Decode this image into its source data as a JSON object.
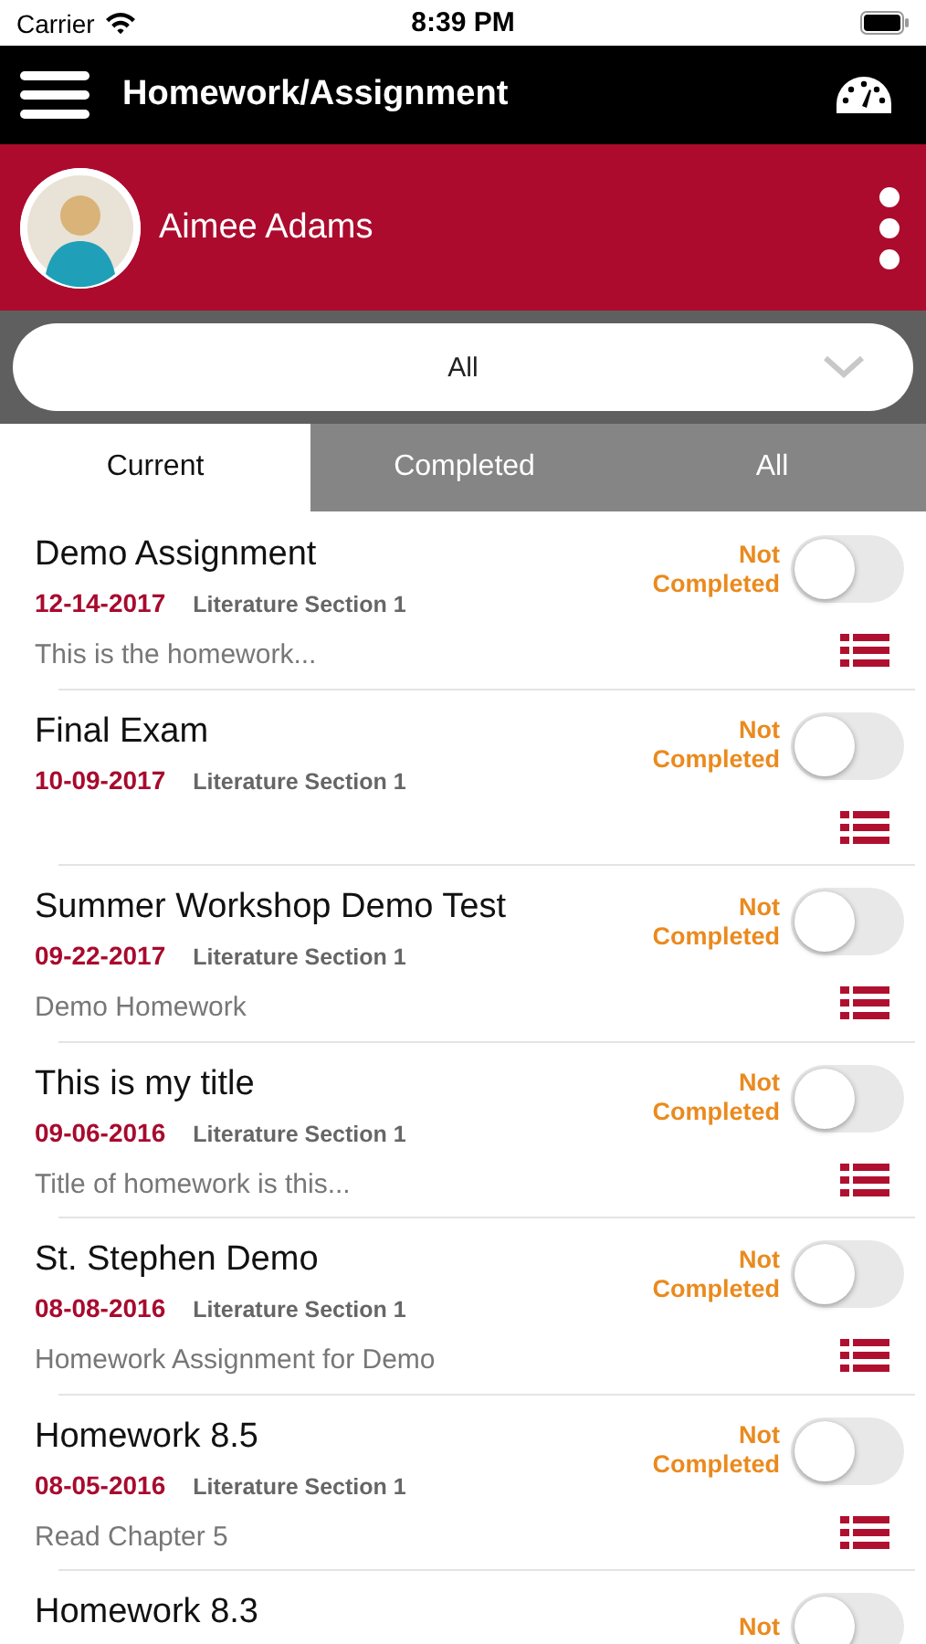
{
  "status_bar": {
    "carrier": "Carrier",
    "time": "8:39 PM"
  },
  "header": {
    "title": "Homework/Assignment"
  },
  "profile": {
    "name": "Aimee Adams"
  },
  "filter": {
    "value": "All"
  },
  "tabs": [
    {
      "label": "Current",
      "selected": true
    },
    {
      "label": "Completed",
      "selected": false
    },
    {
      "label": "All",
      "selected": false
    }
  ],
  "assignments": [
    {
      "title": "Demo Assignment",
      "date": "12-14-2017",
      "section": "Literature Section 1",
      "description": "This is the homework...",
      "status": "Not Completed",
      "on": false
    },
    {
      "title": "Final Exam",
      "date": "10-09-2017",
      "section": "Literature Section 1",
      "status": "Not Completed",
      "on": false
    },
    {
      "title": "Summer Workshop Demo Test",
      "date": "09-22-2017",
      "section": "Literature Section 1",
      "description": "Demo Homework",
      "status": "Not Completed",
      "on": false
    },
    {
      "title": "This is my title",
      "date": "09-06-2016",
      "section": "Literature Section 1",
      "description": "Title of homework is this...",
      "status": "Not Completed",
      "on": false
    },
    {
      "title": "St. Stephen Demo",
      "date": "08-08-2016",
      "section": "Literature Section 1",
      "description": "Homework Assignment for Demo",
      "status": "Not Completed",
      "on": false
    },
    {
      "title": "Homework 8.5",
      "date": "08-05-2016",
      "section": "Literature Section 1",
      "description": "Read Chapter 5",
      "status": "Not Completed",
      "on": false
    },
    {
      "title": "Homework 8.3",
      "status": "Not",
      "on": false
    }
  ]
}
